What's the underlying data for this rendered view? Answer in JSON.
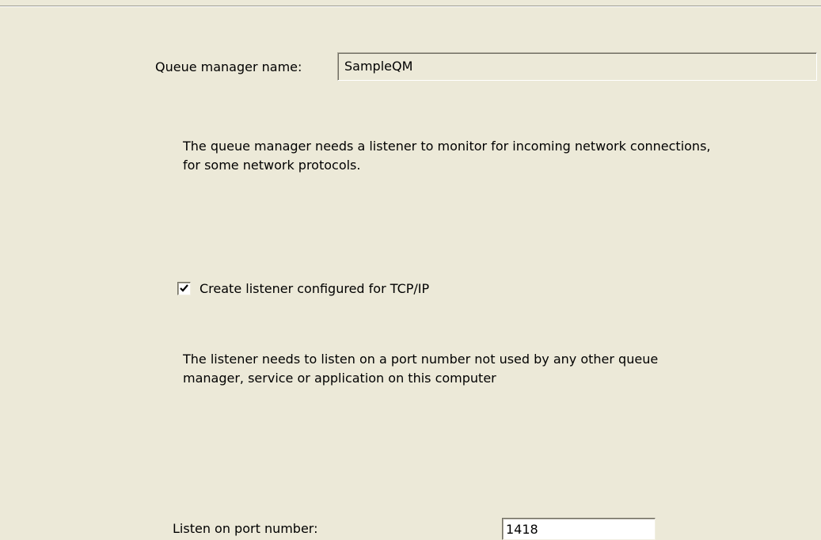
{
  "queue_manager": {
    "label": "Queue manager name:",
    "value": "SampleQM"
  },
  "listener_info": {
    "line1": "The queue manager needs a listener to monitor for incoming network connections,",
    "line2": "for some network protocols."
  },
  "create_listener": {
    "label": "Create listener configured for TCP/IP",
    "checked": true
  },
  "port_info": {
    "line1": "The listener needs to listen on a port number not used by any other queue",
    "line2": "manager, service or application on this computer"
  },
  "port": {
    "label": "Listen on port number:",
    "value": "1418"
  },
  "colors": {
    "dialog_background": "#ece9d8",
    "field_border_dark": "#716f64",
    "field_border_mid": "#aca899"
  }
}
